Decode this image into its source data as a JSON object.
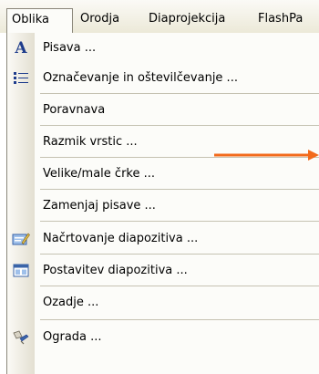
{
  "menubar": {
    "items": [
      {
        "label": "Oblika",
        "active": true
      },
      {
        "label": "Orodja"
      },
      {
        "label": "Diaprojekcija"
      },
      {
        "label": "FlashPa"
      }
    ]
  },
  "menu": {
    "items": [
      {
        "label": "Pisava ...",
        "icon": "font-a-icon"
      },
      {
        "label": "Označevanje in oštevilčevanje ...",
        "icon": "bullet-list-icon"
      },
      {
        "label": "Poravnava"
      },
      {
        "label": "Razmik vrstic ..."
      },
      {
        "label": "Velike/male črke ..."
      },
      {
        "label": "Zamenjaj pisave ..."
      },
      {
        "label": "Načrtovanje diapozitiva ...",
        "icon": "slide-design-icon"
      },
      {
        "label": "Postavitev diapozitiva ...",
        "icon": "slide-layout-icon"
      },
      {
        "label": "Ozadje ..."
      },
      {
        "label": "Ograda ...",
        "icon": "format-placeholder-icon"
      }
    ]
  },
  "annotation": {
    "arrow_color": "#f26a1b"
  }
}
